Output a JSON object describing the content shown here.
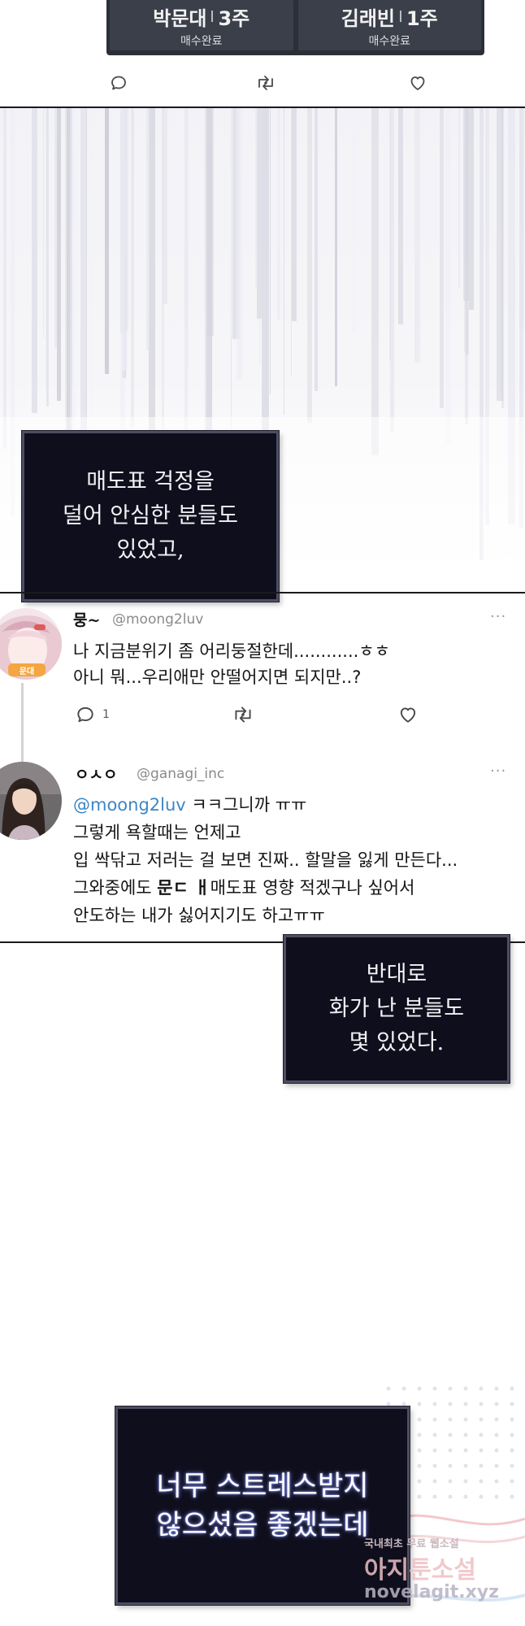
{
  "stock_panel": {
    "cards": [
      {
        "name": "박문대",
        "weeks": "3주",
        "status": "매수완료"
      },
      {
        "name": "김래빈",
        "weeks": "1주",
        "status": "매수완료"
      }
    ]
  },
  "narration": {
    "box1": [
      "매도표 걱정을",
      "덜어 안심한 분들도",
      "있었고,"
    ],
    "box2": [
      "반대로",
      "화가 난 분들도",
      "몇 있었다."
    ],
    "box3": [
      "너무 스트레스받지",
      "않으셨음 좋겠는데"
    ]
  },
  "tweet1": {
    "name": "뭉~",
    "handle": "@moong2luv",
    "more": "···",
    "lines": [
      "나 지금분위기 좀 어리둥절한데............ㅎㅎ",
      "아니 뭐...우리애만 안떨어지면 되지만..?"
    ],
    "reply_count": "1",
    "avatar_badge": "문대"
  },
  "tweet2": {
    "name": "ㅇㅅㅇ",
    "handle": "@ganagi_inc",
    "more": "···",
    "mention": "@moong2luv",
    "line1_rest": " ㅋㅋ그니까 ㅠㅠ",
    "lines": [
      "그렇게 욕할때는 언제고",
      "입 싹닦고 저러는 걸 보면 진짜.. 할말을 잃게 만든다..."
    ],
    "line4_pre": "그와중에도 ",
    "line4_bold": "문ㄷ ㅐ",
    "line4_post": "매도표 영향 적겠구나 싶어서",
    "line5": "안도하는 내가 싫어지기도 하고ㅠㅠ"
  },
  "watermark": {
    "line1": "국내최초 무료 웹소설",
    "line2": "아지툰소설",
    "line3": "novelagit.xyz"
  },
  "icons": [
    "reply-icon",
    "retweet-icon",
    "like-icon",
    "more-icon"
  ],
  "colors": {
    "narration_bg": "#0f0e1c",
    "mention": "#3d86c6",
    "stock_panel": "#2b2f38"
  }
}
